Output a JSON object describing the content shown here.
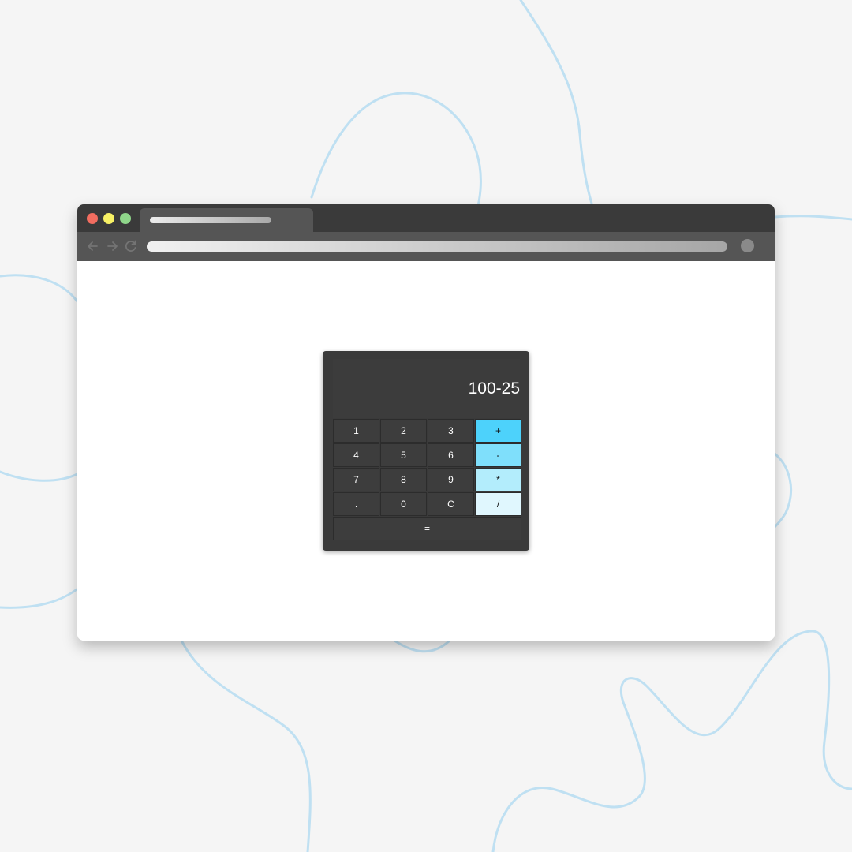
{
  "browser": {
    "traffic_lights": {
      "close": "#f26d60",
      "minimize": "#f8f165",
      "maximize": "#8fd68a"
    },
    "nav_icons": [
      "back-arrow-icon",
      "forward-arrow-icon",
      "reload-icon"
    ]
  },
  "calculator": {
    "display": "100-25",
    "rows": [
      [
        {
          "label": "1",
          "type": "digit"
        },
        {
          "label": "2",
          "type": "digit"
        },
        {
          "label": "3",
          "type": "digit"
        },
        {
          "label": "+",
          "type": "op",
          "color": "#4dd2fb"
        }
      ],
      [
        {
          "label": "4",
          "type": "digit"
        },
        {
          "label": "5",
          "type": "digit"
        },
        {
          "label": "6",
          "type": "digit"
        },
        {
          "label": "-",
          "type": "op",
          "color": "#7fdffb"
        }
      ],
      [
        {
          "label": "7",
          "type": "digit"
        },
        {
          "label": "8",
          "type": "digit"
        },
        {
          "label": "9",
          "type": "digit"
        },
        {
          "label": "*",
          "type": "op",
          "color": "#b3edfc"
        }
      ],
      [
        {
          "label": ".",
          "type": "digit"
        },
        {
          "label": "0",
          "type": "digit"
        },
        {
          "label": "C",
          "type": "digit"
        },
        {
          "label": "/",
          "type": "op",
          "color": "#e0f7fe"
        }
      ],
      [
        {
          "label": "=",
          "type": "equals"
        }
      ]
    ],
    "colors": {
      "body": "#3a3a3a",
      "key": "#3d3d3d",
      "text": "#ffffff"
    }
  }
}
